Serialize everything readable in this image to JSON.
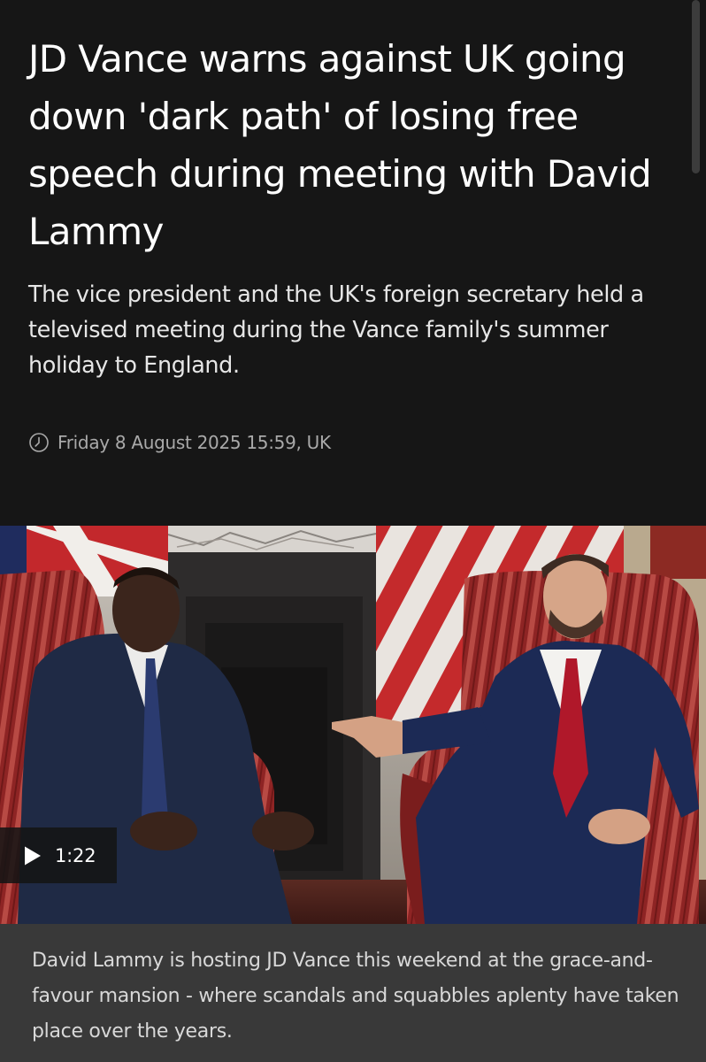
{
  "article": {
    "headline": "JD Vance warns against UK going down 'dark path' of losing free speech during meeting with David Lammy",
    "standfirst": "The vice president and the UK's foreign secretary held a televised meeting during the Vance family's summer holiday to England.",
    "timestamp": "Friday 8 August 2025 15:59, UK"
  },
  "video": {
    "duration": "1:22",
    "icon": "play-icon"
  },
  "caption": "David Lammy is hosting JD Vance this weekend at the grace-and-favour mansion - where scandals and squabbles aplenty have taken place over the years.",
  "colors": {
    "background": "#161616",
    "caption_background": "#393939",
    "timestamp": "#a9a9a9"
  }
}
